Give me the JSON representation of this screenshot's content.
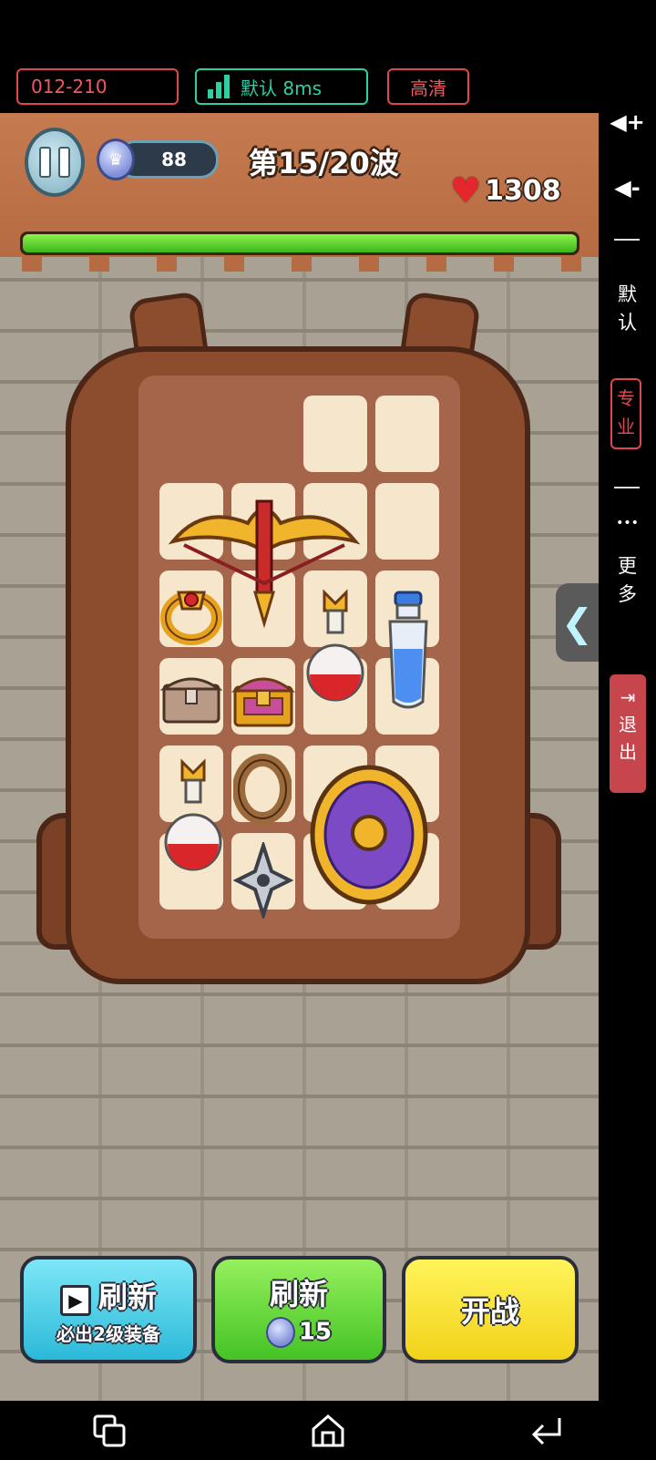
{
  "status_bar": {
    "session_code": "012-210",
    "network": "默认 8ms",
    "quality": "高清"
  },
  "side_panel": {
    "vol_up": "◀+",
    "vol_down": "◀-",
    "mode_default": [
      "默",
      "认"
    ],
    "mode_pro": [
      "专",
      "业"
    ],
    "more_dots": "•••",
    "more": [
      "更",
      "多"
    ],
    "exit_icon": "⇥",
    "exit": [
      "退",
      "出"
    ]
  },
  "hud": {
    "gems": "88",
    "wave": "第15/20波",
    "hp": "1308",
    "hp_fraction": 1.0
  },
  "backpack": {
    "items": [
      "crossbow",
      "golden-ring-ruby",
      "red-potion",
      "blue-potion",
      "wooden-chest",
      "golden-chest",
      "red-potion",
      "bronze-ring",
      "purple-round-shield",
      "steel-shuriken"
    ]
  },
  "buttons": {
    "ad_refresh_title": "刷新",
    "ad_refresh_sub": "必出2级装备",
    "refresh_title": "刷新",
    "refresh_cost": "15",
    "fight": "开战"
  },
  "colors": {
    "hp_bar": "#45c326",
    "accent_red": "#e0484c",
    "accent_teal": "#2fcfa4"
  }
}
